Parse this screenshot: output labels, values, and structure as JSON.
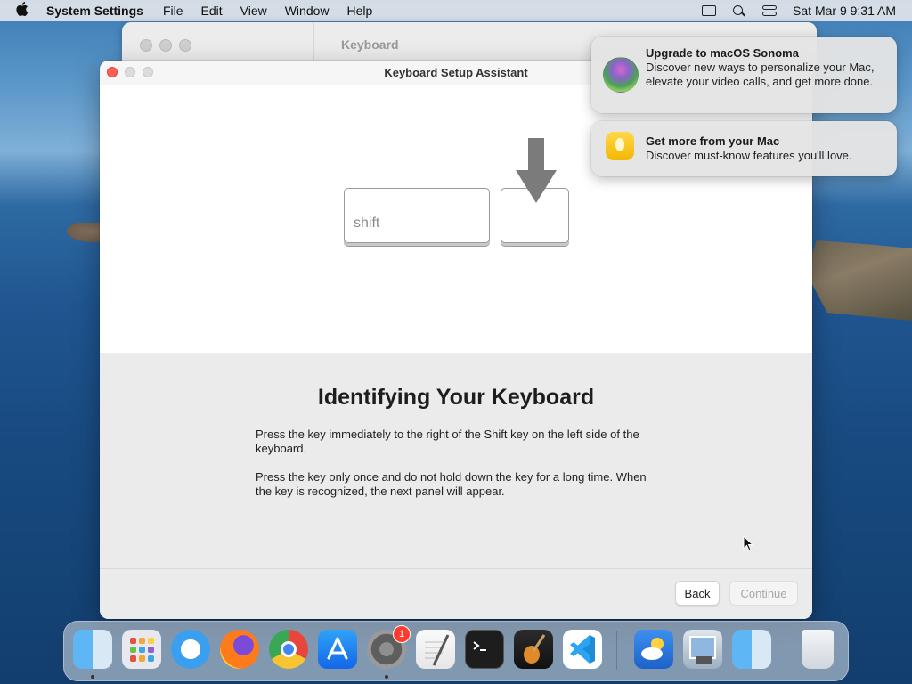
{
  "menubar": {
    "app_name": "System Settings",
    "menus": [
      "File",
      "Edit",
      "View",
      "Window",
      "Help"
    ],
    "datetime": "Sat Mar 9  9:31 AM"
  },
  "background_window": {
    "title": "Keyboard"
  },
  "window": {
    "title": "Keyboard Setup Assistant",
    "key_label": "shift",
    "heading": "Identifying Your Keyboard",
    "paragraph1": "Press the key immediately to the right of the Shift key on the left side of the keyboard.",
    "paragraph2": "Press the key only once and do not hold down the key for a long time. When the key is recognized, the next panel will appear.",
    "back_label": "Back",
    "continue_label": "Continue"
  },
  "notifications": [
    {
      "title": "Upgrade to macOS Sonoma",
      "body": "Discover new ways to personalize your Mac, elevate your video calls, and get more done.",
      "icon": "macos-sonoma-icon"
    },
    {
      "title": "Get more from your Mac",
      "body": "Discover must-know features you'll love.",
      "icon": "tips-icon"
    }
  ],
  "dock": {
    "apps": [
      "Finder",
      "Launchpad",
      "Safari",
      "Firefox",
      "Chrome",
      "App Store",
      "System Settings",
      "TextEdit",
      "Terminal",
      "GarageBand",
      "Visual Studio Code",
      "Weather",
      "Preview",
      "Finder",
      "Trash"
    ],
    "settings_badge": "1"
  },
  "colors": {
    "close_button": "#fe5f57",
    "badge": "#ff3b30",
    "arrow": "#7b7b7b"
  }
}
